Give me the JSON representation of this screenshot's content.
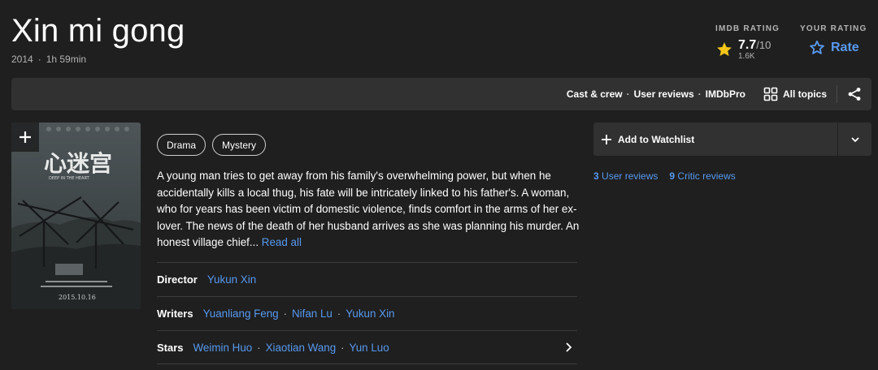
{
  "title": "Xin mi gong",
  "meta": {
    "year": "2014",
    "separator": "·",
    "runtime": "1h 59min"
  },
  "imdb_rating": {
    "label": "IMDb RATING",
    "score": "7.7",
    "max": "/10",
    "votes": "1.6K",
    "icon": "star-filled-icon",
    "color": "#f5c518"
  },
  "your_rating": {
    "label": "YOUR RATING",
    "button_label": "Rate",
    "icon": "star-outline-icon"
  },
  "subnav": {
    "links": [
      "Cast & crew",
      "User reviews",
      "IMDbPro"
    ],
    "all_topics_label": "All topics",
    "icons": [
      "grid-icon",
      "share-icon"
    ]
  },
  "poster": {
    "add_icon": "plus-icon",
    "title_art": "心迷宫",
    "subtitle_art": "DEEP IN THE HEART",
    "date_art": "2015.10.16"
  },
  "genres": [
    "Drama",
    "Mystery"
  ],
  "plot": {
    "text": "A young man tries to get away from his family's overwhelming power, but when he accidentally kills a local thug, his fate will be intricately linked to his father's. A woman, who for years has been victim of domestic violence, finds comfort in the arms of her ex-lover. The news of the death of her husband arrives as she was planning his murder. An honest village chief...",
    "read_all": "Read all"
  },
  "credits": {
    "director": {
      "label": "Director",
      "names": [
        "Yukun Xin"
      ]
    },
    "writers": {
      "label": "Writers",
      "names": [
        "Yuanliang Feng",
        "Nifan Lu",
        "Yukun Xin"
      ]
    },
    "stars": {
      "label": "Stars",
      "names": [
        "Weimin Huo",
        "Xiaotian Wang",
        "Yun Luo"
      ]
    },
    "separator": "·"
  },
  "watchlist": {
    "label": "Add to Watchlist",
    "icons": [
      "plus-icon",
      "chevron-down-icon"
    ]
  },
  "reviews": {
    "user": {
      "count": "3",
      "label": "User reviews"
    },
    "critic": {
      "count": "9",
      "label": "Critic reviews"
    }
  },
  "colors": {
    "accent_blue": "#5799ef",
    "star_yellow": "#f5c518",
    "background": "#1f1f1f",
    "surface": "#313131"
  }
}
